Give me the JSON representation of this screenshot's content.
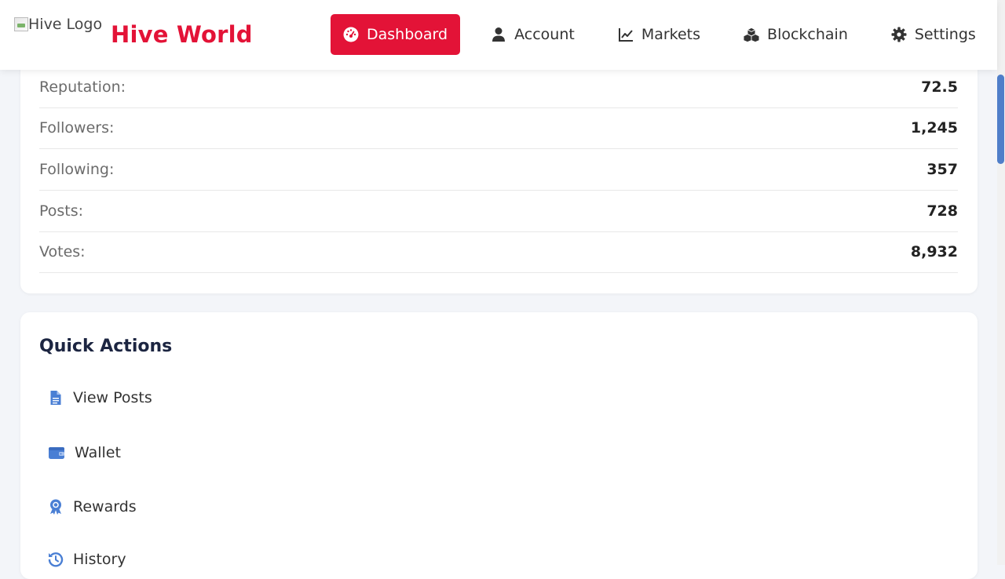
{
  "header": {
    "logo_alt": "Hive Logo",
    "brand": "Hive World",
    "brand_color": "#e31337"
  },
  "nav": {
    "items": [
      {
        "label": "Dashboard",
        "icon": "dashboard-gauge-icon",
        "active": true
      },
      {
        "label": "Account",
        "icon": "user-icon",
        "active": false
      },
      {
        "label": "Markets",
        "icon": "line-chart-icon",
        "active": false
      },
      {
        "label": "Blockchain",
        "icon": "cubes-icon",
        "active": false
      },
      {
        "label": "Settings",
        "icon": "gear-icon",
        "active": false
      }
    ]
  },
  "stats": {
    "rows": [
      {
        "label": "Reputation:",
        "value": "72.5"
      },
      {
        "label": "Followers:",
        "value": "1,245"
      },
      {
        "label": "Following:",
        "value": "357"
      },
      {
        "label": "Posts:",
        "value": "728"
      },
      {
        "label": "Votes:",
        "value": "8,932"
      }
    ]
  },
  "quick_actions": {
    "title": "Quick Actions",
    "items": [
      {
        "label": "View Posts",
        "icon": "file-text-icon"
      },
      {
        "label": "Wallet",
        "icon": "wallet-icon"
      },
      {
        "label": "Rewards",
        "icon": "award-icon"
      },
      {
        "label": "History",
        "icon": "history-icon"
      }
    ],
    "icon_color": "#4a7fd4"
  }
}
